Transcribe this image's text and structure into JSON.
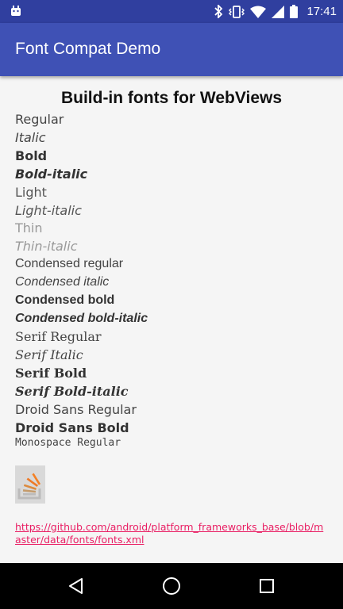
{
  "status_bar": {
    "time": "17:41",
    "icons": [
      "android-icon",
      "bluetooth-icon",
      "vibrate-icon",
      "wifi-icon",
      "signal-icon",
      "battery-icon"
    ]
  },
  "toolbar": {
    "title": "Font Compat Demo",
    "color": "#3f51b5"
  },
  "content": {
    "heading": "Build-in fonts for WebViews",
    "samples": [
      "Regular",
      "Italic",
      "Bold",
      "Bold-italic",
      "Light",
      "Light-italic",
      "Thin",
      "Thin-italic",
      "Condensed regular",
      "Condensed italic",
      "Condensed bold",
      "Condensed bold-italic",
      "Serif Regular",
      "Serif Italic",
      "Serif Bold",
      "Serif Bold-italic",
      "Droid Sans Regular",
      "Droid Sans Bold",
      "Monospace Regular"
    ],
    "image_icon": "stackoverflow-icon",
    "link_text": "https://github.com/android/platform_frameworks_base/blob/master/data/fonts/fonts.xml",
    "link_color": "#e91e63"
  },
  "nav_bar": {
    "buttons": [
      "back-icon",
      "home-icon",
      "recents-icon"
    ]
  }
}
